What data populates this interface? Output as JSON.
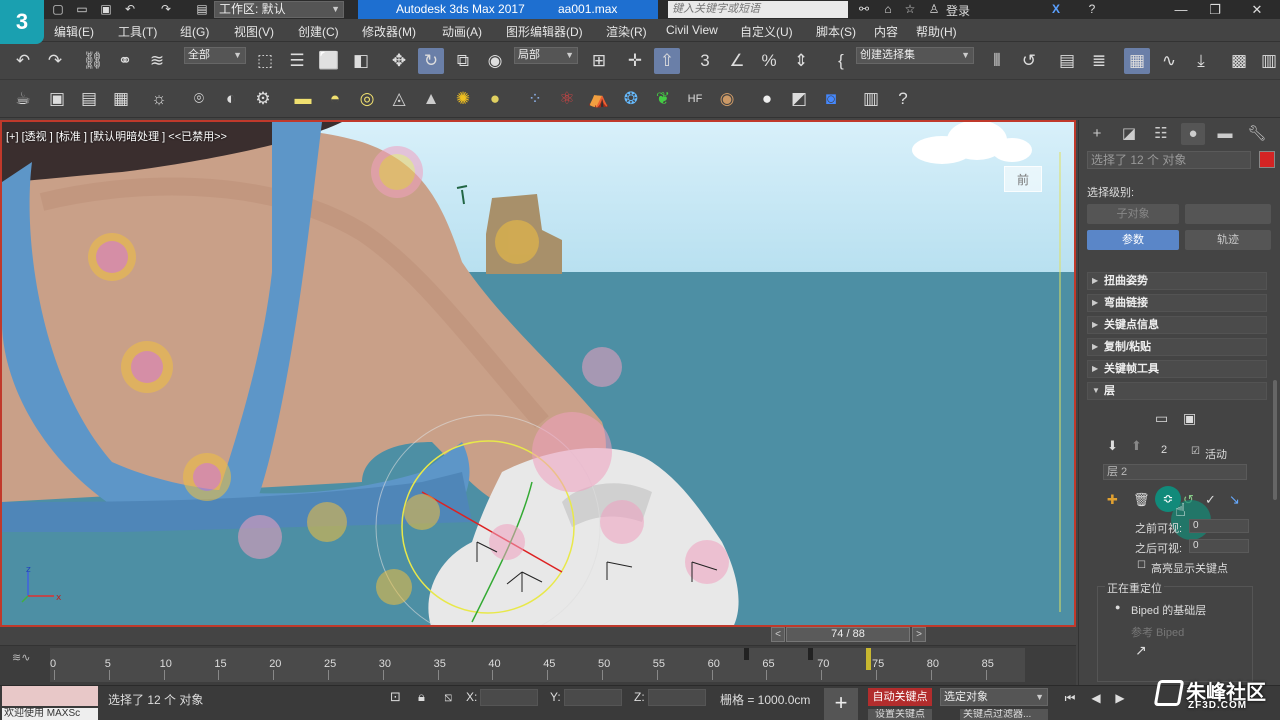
{
  "titlebar": {
    "logo_text": "3",
    "workspace": "工作区: 默认",
    "app_title": "Autodesk 3ds Max 2017",
    "file_name": "aa001.max",
    "search_placeholder": "键入关键字或短语",
    "login": "登录"
  },
  "menu": [
    "编辑(E)",
    "工具(T)",
    "组(G)",
    "视图(V)",
    "创建(C)",
    "修改器(M)",
    "动画(A)",
    "图形编辑器(D)",
    "渲染(R)",
    "Civil View",
    "自定义(U)",
    "脚本(S)",
    "内容",
    "帮助(H)"
  ],
  "toolbar": {
    "filter_dropdown": "全部",
    "refcoord_dropdown": "局部",
    "selection_set": "创建选择集"
  },
  "viewport": {
    "label": "[+] [透视 ] [标准 ] [默认明暗处理 ] <<已禁用>>",
    "viewcube_text": "前"
  },
  "timeline": {
    "frame": "74 / 88",
    "ticks": [
      "0",
      "5",
      "10",
      "15",
      "20",
      "25",
      "30",
      "35",
      "40",
      "45",
      "50",
      "55",
      "60",
      "65",
      "70",
      "75",
      "80",
      "85"
    ]
  },
  "status": {
    "message": "选择了 12 个 对象",
    "listener": "欢迎使用 MAXSc",
    "x_label": "X:",
    "y_label": "Y:",
    "z_label": "Z:",
    "grid": "栅格 = 1000.0cm",
    "auto_key": "自动关键点",
    "set_key": "设置关键点",
    "selected_dropdown": "选定对象",
    "key_filters": "关键点过滤器..."
  },
  "command_panel": {
    "selection_count": "选择了 12 个 对象",
    "sel_color": "#d42424",
    "selection_level": "选择级别:",
    "subobject_btn": "子对象",
    "params_btn": "参数",
    "track_btn": "轨迹",
    "rollouts": [
      "扭曲姿势",
      "弯曲链接",
      "关键点信息",
      "复制/粘贴",
      "关键帧工具",
      "层"
    ],
    "layer_index": "2",
    "active_label": "活动",
    "layer_name": "层 2",
    "before_visible": "之前可视:",
    "before_value": "0",
    "after_visible": "之后可视:",
    "after_value": "0",
    "highlight_keys": "高亮显示关键点",
    "retarget_title": "正在重定位",
    "biped_base": "Biped 的基础层",
    "ref_biped": "参考 Biped"
  },
  "watermark": {
    "title": "朱峰社区",
    "sub": "ZF3D.COM"
  }
}
